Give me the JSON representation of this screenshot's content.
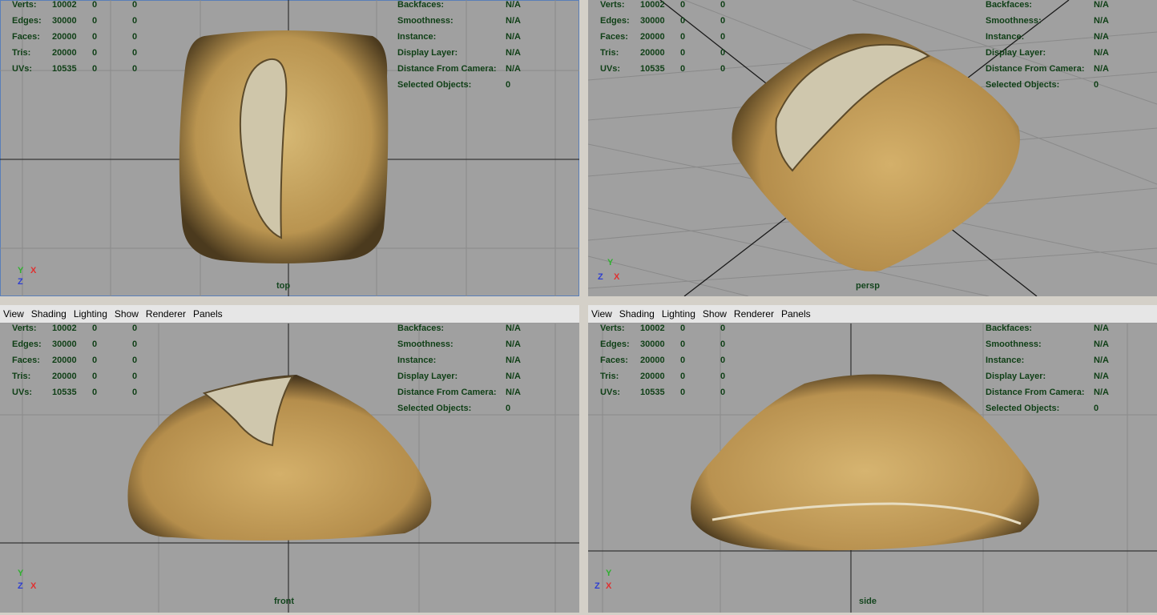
{
  "menu": [
    "View",
    "Shading",
    "Lighting",
    "Show",
    "Renderer",
    "Panels"
  ],
  "stats": [
    {
      "label": "Verts:",
      "v1": "10002",
      "v2": "0",
      "v3": "0"
    },
    {
      "label": "Edges:",
      "v1": "30000",
      "v2": "0",
      "v3": "0"
    },
    {
      "label": "Faces:",
      "v1": "20000",
      "v2": "0",
      "v3": "0"
    },
    {
      "label": "Tris:",
      "v1": "20000",
      "v2": "0",
      "v3": "0"
    },
    {
      "label": "UVs:",
      "v1": "10535",
      "v2": "0",
      "v3": "0"
    }
  ],
  "info": [
    {
      "label": "Backfaces:",
      "value": "N/A"
    },
    {
      "label": "Smoothness:",
      "value": "N/A"
    },
    {
      "label": "Instance:",
      "value": "N/A"
    },
    {
      "label": "Display Layer:",
      "value": "N/A"
    },
    {
      "label": "Distance From Camera:",
      "value": "N/A"
    },
    {
      "label": "Selected Objects:",
      "value": "0"
    }
  ],
  "viewports": {
    "top": {
      "camera": "top",
      "axis_a": "Y",
      "axis_b": "X",
      "axis_c": "Z"
    },
    "persp": {
      "camera": "persp",
      "axis_a": "Y",
      "axis_b": "X",
      "axis_c": "Z"
    },
    "front": {
      "camera": "front",
      "axis_a": "Y",
      "axis_b": "X",
      "axis_c": "Z"
    },
    "side": {
      "camera": "side",
      "axis_a": "Y",
      "axis_b": "X",
      "axis_c": "Z"
    }
  },
  "colors": {
    "viewport_bg": "#a0a0a0",
    "hud_text": "#0f3f16",
    "axis_x": "#e03030",
    "axis_y": "#2fb02f",
    "axis_z": "#2f3fd0",
    "bread": "#c9a862"
  }
}
